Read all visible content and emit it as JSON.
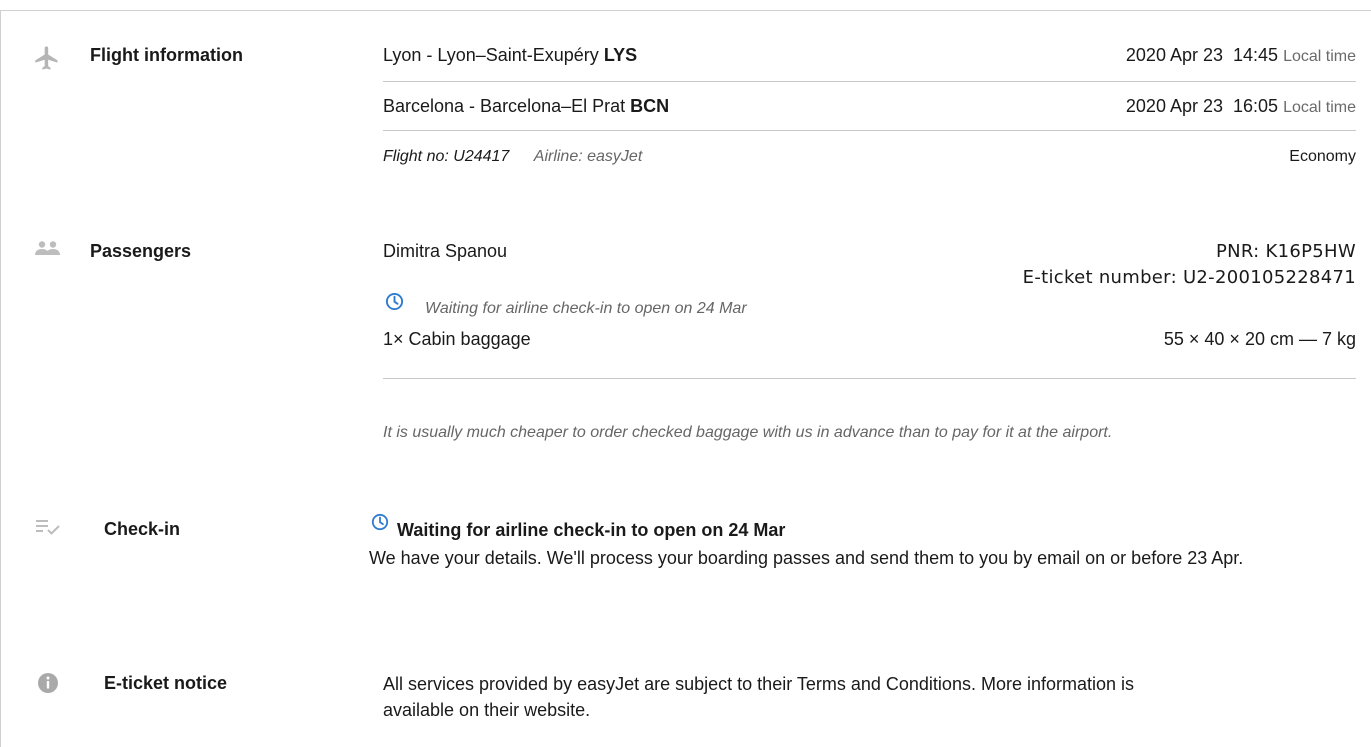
{
  "colors": {
    "accent": "#2e7bcf",
    "text": "#1a1a1a",
    "muted": "#6a6a6a",
    "icon": "#b5b5b5",
    "divider": "#c8c8c8"
  },
  "flight": {
    "title": "Flight information",
    "departure": {
      "place": "Lyon - Lyon–Saint-Exupéry",
      "code": "LYS",
      "date": "2020 Apr 23",
      "time": "14:45",
      "time_note": "Local time"
    },
    "arrival": {
      "place": "Barcelona - Barcelona–El Prat",
      "code": "BCN",
      "date": "2020 Apr 23",
      "time": "16:05",
      "time_note": "Local time"
    },
    "flight_no": "Flight no: U24417",
    "airline": "Airline: easyJet",
    "cabin_class": "Economy"
  },
  "passengers": {
    "title": "Passengers",
    "name": "Dimitra Spanou",
    "pnr": "PNR: K16P5HW",
    "eticket": "E-ticket number: U2-200105228471",
    "checkin_status": "Waiting for airline check-in to open on 24 Mar",
    "baggage_label": "1× Cabin baggage",
    "baggage_size": "55 × 40 × 20 cm — 7 kg",
    "baggage_tip": "It is usually much cheaper to order checked baggage with us in advance than to pay for it at the airport."
  },
  "checkin": {
    "title": "Check-in",
    "status": "Waiting for airline check-in to open on 24 Mar",
    "description": "We have your details. We'll process your boarding passes and send them to you by email on or before 23 Apr."
  },
  "eticket_notice": {
    "title": "E-ticket notice",
    "text": "All services provided by easyJet are subject to their Terms and Conditions. More information is available on their website."
  },
  "icons": {
    "flight": "airplane-icon",
    "passengers": "people-icon",
    "checkin": "checklist-icon",
    "notice": "info-icon",
    "status": "clock-icon"
  }
}
